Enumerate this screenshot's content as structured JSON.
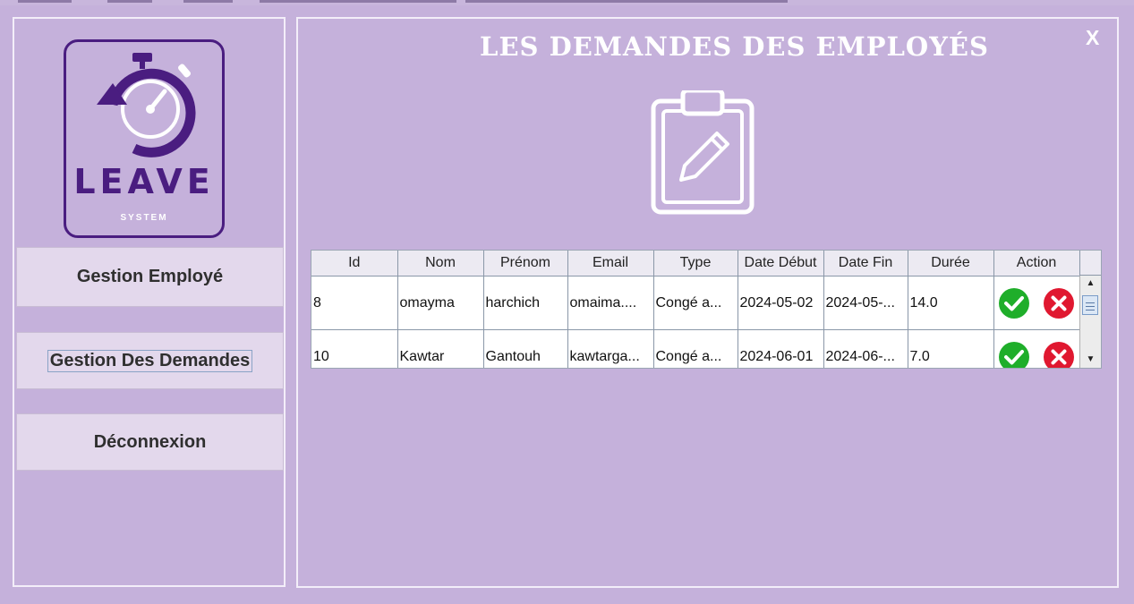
{
  "sidebar": {
    "logo_title": "LEAVE",
    "logo_subtitle": "SYSTEM",
    "items": [
      {
        "label": "Gestion Employé"
      },
      {
        "label": "Gestion Des Demandes"
      },
      {
        "label": "Déconnexion"
      }
    ]
  },
  "main": {
    "close_label": "X",
    "title": "LES DEMANDES DES EMPLOYÉS"
  },
  "table": {
    "columns": [
      "Id",
      "Nom",
      "Prénom",
      "Email",
      "Type",
      "Date Début",
      "Date Fin",
      "Durée",
      "Action"
    ],
    "rows": [
      {
        "id": "8",
        "nom": "omayma",
        "prenom": "harchich",
        "email": "omaima....",
        "type": "Congé a...",
        "date_debut": "2024-05-02",
        "date_fin": "2024-05-...",
        "duree": "14.0"
      },
      {
        "id": "10",
        "nom": "Kawtar",
        "prenom": "Gantouh",
        "email": "kawtarga...",
        "type": "Congé a...",
        "date_debut": "2024-06-01",
        "date_fin": "2024-06-...",
        "duree": "7.0"
      }
    ],
    "action_icons": [
      "check-icon",
      "reject-icon"
    ]
  },
  "colors": {
    "background": "#c5b1db",
    "logo_purple": "#4a1d80",
    "approve_green": "#1fae2a",
    "reject_red": "#e01830"
  }
}
